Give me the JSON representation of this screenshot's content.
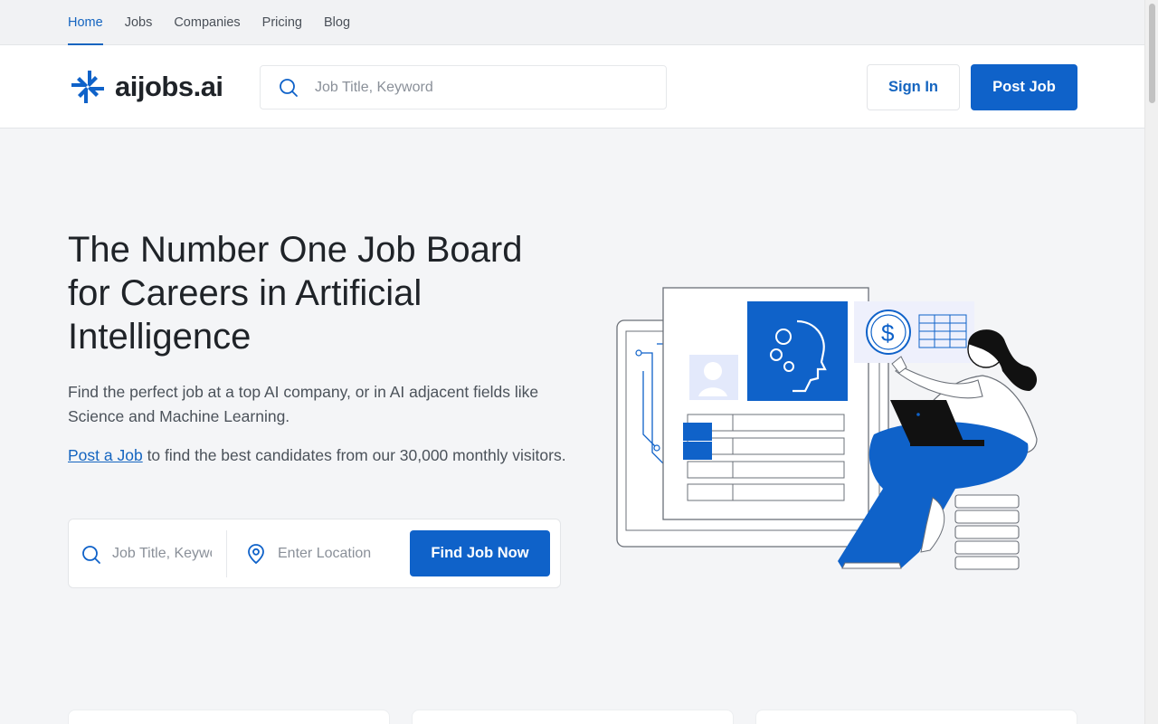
{
  "topnav": {
    "items": [
      {
        "label": "Home",
        "active": true
      },
      {
        "label": "Jobs",
        "active": false
      },
      {
        "label": "Companies",
        "active": false
      },
      {
        "label": "Pricing",
        "active": false
      },
      {
        "label": "Blog",
        "active": false
      }
    ]
  },
  "header": {
    "logo_text": "aijobs.ai",
    "search_placeholder": "Job Title, Keyword",
    "signin_label": "Sign In",
    "post_job_label": "Post Job"
  },
  "hero": {
    "title": "The Number One Job Board for Careers in Artificial Intelligence",
    "description": "Find the perfect job at a top AI company, or in AI adjacent fields like Science and Machine Learning.",
    "post_link_label": "Post a Job",
    "post_text": " to find the best candidates from our 30,000 monthly visitors."
  },
  "search": {
    "keyword_placeholder": "Job Title, Keyword",
    "location_placeholder": "Enter Location",
    "button_label": "Find Job Now"
  },
  "colors": {
    "accent": "#0f62c9",
    "link": "#1565c0",
    "background": "#f4f5f7"
  },
  "icons": {
    "logo": "aijobs-logo-icon",
    "search": "search-icon",
    "location": "location-pin-icon"
  }
}
